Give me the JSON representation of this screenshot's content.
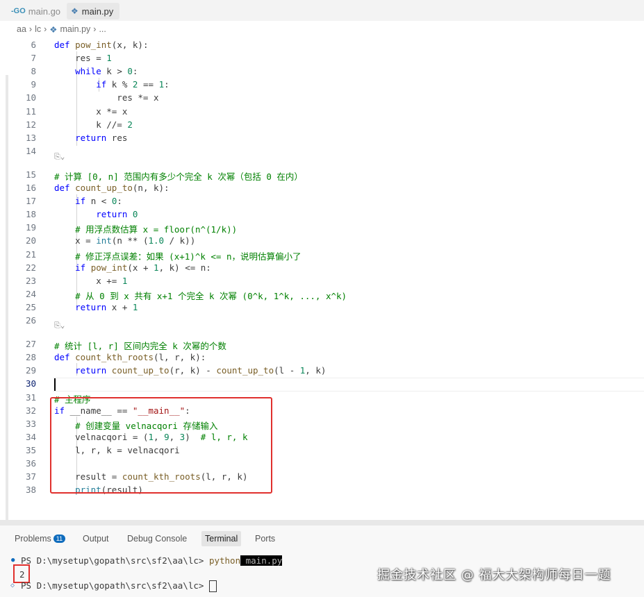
{
  "tabs": [
    {
      "label": "main.go",
      "icon": "go-icon",
      "active": false
    },
    {
      "label": "main.py",
      "icon": "python-icon",
      "active": true
    }
  ],
  "breadcrumb": [
    "aa",
    "lc",
    "main.py",
    "..."
  ],
  "lens_label": "⎘⌄",
  "code": {
    "line_numbers": [
      "6",
      "7",
      "8",
      "9",
      "10",
      "11",
      "12",
      "13",
      "14",
      "15",
      "16",
      "17",
      "18",
      "19",
      "20",
      "21",
      "22",
      "23",
      "24",
      "25",
      "26",
      "27",
      "28",
      "29",
      "30",
      "31",
      "32",
      "33",
      "34",
      "35",
      "36",
      "37",
      "38"
    ],
    "lines": [
      "def pow_int(x, k):",
      "    res = 1",
      "    while k > 0:",
      "        if k % 2 == 1:",
      "            res *= x",
      "        x *= x",
      "        k //= 2",
      "    return res",
      "",
      "# 计算 [0, n] 范围内有多少个完全 k 次幂（包括 0 在内）",
      "def count_up_to(n, k):",
      "    if n < 0:",
      "        return 0",
      "    # 用浮点数估算 x = floor(n^(1/k))",
      "    x = int(n ** (1.0 / k))",
      "    # 修正浮点误差：如果 (x+1)^k <= n，说明估算偏小了",
      "    if pow_int(x + 1, k) <= n:",
      "        x += 1",
      "    # 从 0 到 x 共有 x+1 个完全 k 次幂 (0^k, 1^k, ..., x^k)",
      "    return x + 1",
      "",
      "# 统计 [l, r] 区间内完全 k 次幂的个数",
      "def count_kth_roots(l, r, k):",
      "    return count_up_to(r, k) - count_up_to(l - 1, k)",
      "",
      "# 主程序",
      "if __name__ == \"__main__\":",
      "    # 创建变量 velnacqori 存储输入",
      "    velnacqori = (1, 9, 3)  # l, r, k",
      "    l, r, k = velnacqori",
      "",
      "    result = count_kth_roots(l, r, k)",
      "    print(result)"
    ]
  },
  "panel": {
    "tabs": [
      "Problems",
      "Output",
      "Debug Console",
      "Terminal",
      "Ports"
    ],
    "problems_count": "11",
    "active_tab": "Terminal"
  },
  "terminal": {
    "prompt1": "PS D:\\mysetup\\gopath\\src\\sf2\\aa\\lc> ",
    "cmd1": "python",
    "cmd1_arg": " main.py",
    "output": "2",
    "prompt2": "PS D:\\mysetup\\gopath\\src\\sf2\\aa\\lc> "
  },
  "watermark": "掘金技术社区 @ 福大大架构师每日一题",
  "colors": {
    "keyword": "#0000ff",
    "function": "#795e26",
    "number": "#098658",
    "comment": "#008000",
    "string": "#a31515",
    "highlight_box": "#e0302d",
    "badge": "#0f6cbd"
  }
}
